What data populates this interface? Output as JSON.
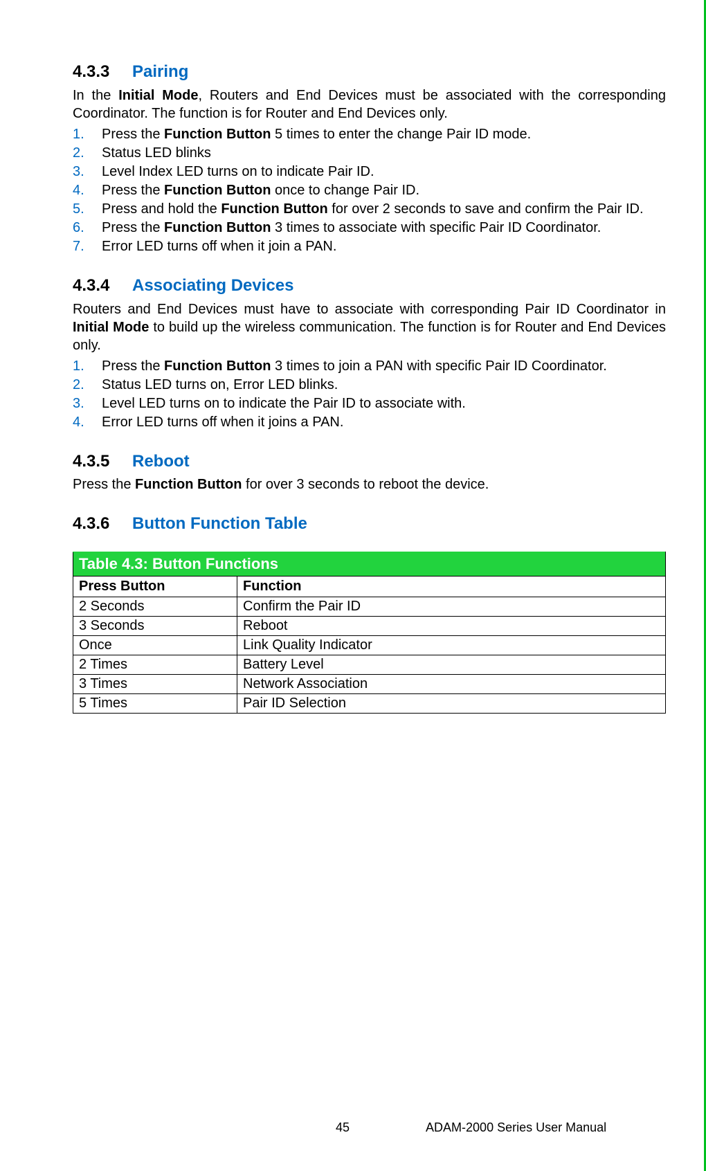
{
  "sections": {
    "s433": {
      "num": "4.3.3",
      "title": "Pairing",
      "intro_pre": "In the ",
      "intro_bold": "Initial Mode",
      "intro_post": ", Routers and End Devices must be associated with the corresponding Coordinator. The function is for Router and End Devices only.",
      "items": [
        {
          "n": "1.",
          "pre": "Press the ",
          "b": "Function Button",
          "post": " 5 times to enter the change Pair ID mode."
        },
        {
          "n": "2.",
          "pre": "Status LED blinks",
          "b": "",
          "post": ""
        },
        {
          "n": "3.",
          "pre": "Level Index LED turns on to indicate Pair ID.",
          "b": "",
          "post": ""
        },
        {
          "n": "4.",
          "pre": "Press the ",
          "b": "Function Button",
          "post": " once to change Pair ID."
        },
        {
          "n": "5.",
          "pre": "Press and hold the ",
          "b": "Function Button",
          "post": " for over 2 seconds to save and confirm the Pair ID."
        },
        {
          "n": "6.",
          "pre": "Press the ",
          "b": "Function Button",
          "post": " 3 times to associate with specific Pair ID Coordinator."
        },
        {
          "n": "7.",
          "pre": "Error LED turns off when it join a PAN.",
          "b": "",
          "post": ""
        }
      ]
    },
    "s434": {
      "num": "4.3.4",
      "title": "Associating Devices",
      "intro_pre": "Routers and End Devices must have to associate with corresponding Pair ID Coordinator in ",
      "intro_bold": "Initial Mode",
      "intro_post": " to build up the wireless communication. The function is for Router and End Devices only.",
      "items": [
        {
          "n": "1.",
          "pre": "Press the ",
          "b": "Function Button",
          "post": " 3 times to join a PAN with specific Pair ID Coordinator."
        },
        {
          "n": "2.",
          "pre": "Status LED turns on, Error LED blinks.",
          "b": "",
          "post": ""
        },
        {
          "n": "3.",
          "pre": "Level LED turns on to indicate the Pair ID to associate with.",
          "b": "",
          "post": ""
        },
        {
          "n": "4.",
          "pre": "Error LED turns off when it joins a PAN.",
          "b": "",
          "post": ""
        }
      ]
    },
    "s435": {
      "num": "4.3.5",
      "title": "Reboot",
      "text_pre": "Press the ",
      "text_bold": "Function Button",
      "text_post": " for over 3 seconds to reboot the device."
    },
    "s436": {
      "num": "4.3.6",
      "title": "Button Function Table"
    }
  },
  "table": {
    "title": "Table 4.3: Button Functions",
    "headers": {
      "c1": "Press Button",
      "c2": "Function"
    },
    "rows": [
      {
        "c1": "2 Seconds",
        "c2": "Confirm the Pair ID"
      },
      {
        "c1": "3 Seconds",
        "c2": "Reboot"
      },
      {
        "c1": "Once",
        "c2": "Link Quality Indicator"
      },
      {
        "c1": "2 Times",
        "c2": "Battery Level"
      },
      {
        "c1": "3 Times",
        "c2": "Network Association"
      },
      {
        "c1": "5 Times",
        "c2": "Pair ID Selection"
      }
    ]
  },
  "footer": {
    "page": "45",
    "doc": "ADAM-2000 Series User Manual"
  }
}
